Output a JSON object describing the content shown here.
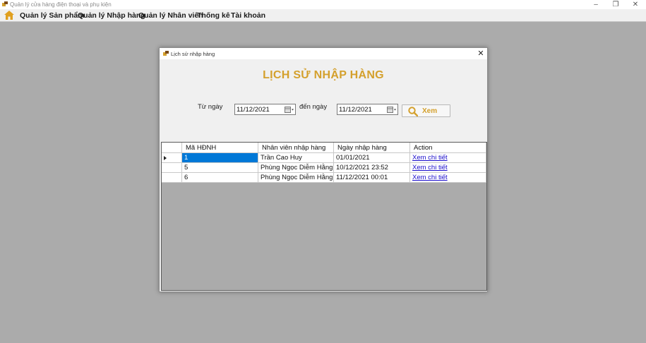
{
  "app": {
    "title": "Quản lý cửa hàng điện thoại và phụ kiện"
  },
  "menu": {
    "items": [
      "Quản lý Sản phẩm",
      "Quản lý Nhập hàng",
      "Quản lý Nhân viên",
      "Thống kê",
      "Tài khoản"
    ]
  },
  "dialog": {
    "title": "Lịch sử nhập hàng",
    "heading": "LỊCH SỬ NHẬP HÀNG",
    "from_label": "Từ ngày",
    "from_value": "11/12/2021",
    "to_label": "đến ngày",
    "to_value": "11/12/2021",
    "view_button": "Xem"
  },
  "grid": {
    "columns": [
      "Mã HĐNH",
      "Nhân viên nhập hàng",
      "Ngày nhập hàng",
      "Action"
    ],
    "rows": [
      {
        "id": "1",
        "employee": "Trần Cao Huy",
        "date": "01/01/2021",
        "action": "Xem chi tiết"
      },
      {
        "id": "5",
        "employee": "Phùng Ngọc Diễm Hằng",
        "date": "10/12/2021 23:52",
        "action": "Xem chi tiết"
      },
      {
        "id": "6",
        "employee": "Phùng Ngọc Diễm Hằng",
        "date": "11/12/2021 00:01",
        "action": "Xem chi tiết"
      }
    ]
  },
  "colors": {
    "accent": "#d4a02c",
    "selection": "#0078d7",
    "workspace": "#ababab",
    "link": "#1a0dcc"
  },
  "icons": [
    "app-icon",
    "home-icon",
    "calendar-icon",
    "search-icon",
    "close-icon",
    "minimize-icon",
    "maximize-icon",
    "row-pointer-icon"
  ]
}
